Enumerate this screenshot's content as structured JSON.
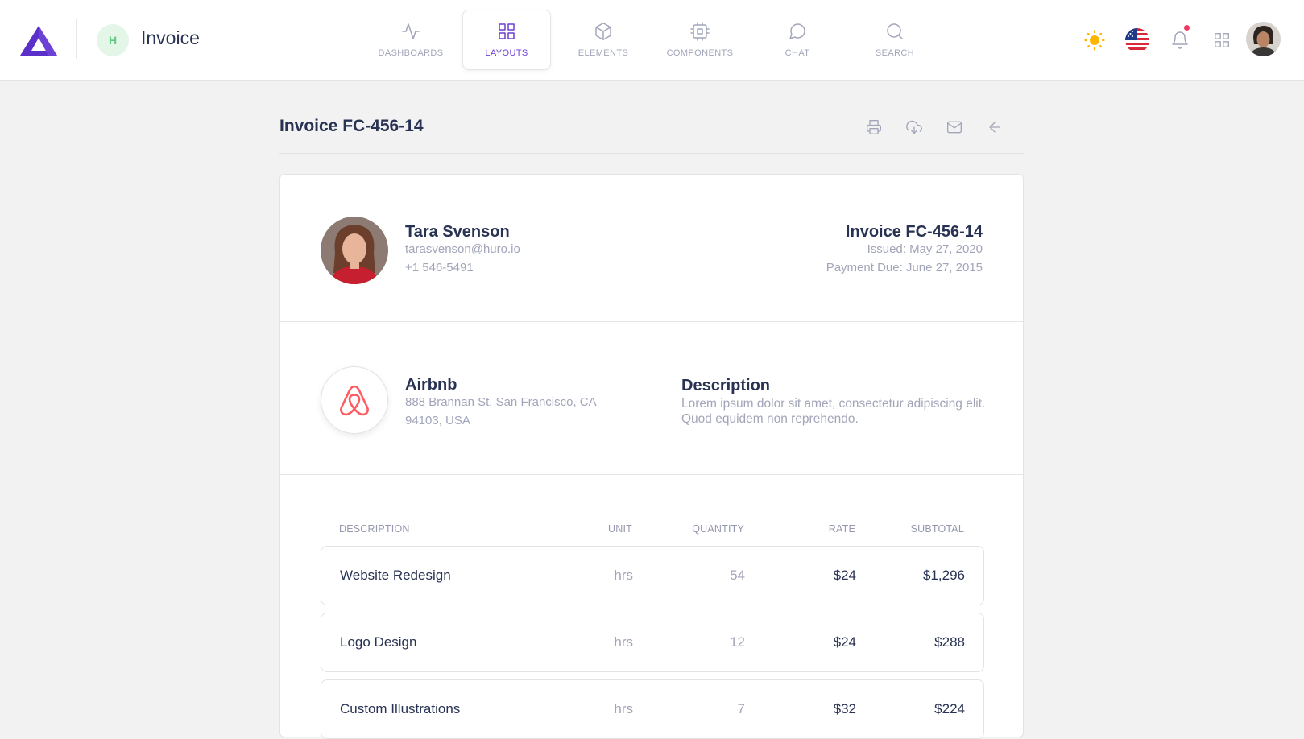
{
  "header": {
    "project_initial": "H",
    "title": "Invoice"
  },
  "nav": [
    {
      "label": "Dashboards",
      "icon": "activity-icon"
    },
    {
      "label": "Layouts",
      "icon": "grid-icon",
      "active": true
    },
    {
      "label": "Elements",
      "icon": "box-icon"
    },
    {
      "label": "Components",
      "icon": "cpu-icon"
    },
    {
      "label": "Chat",
      "icon": "message-circle-icon"
    },
    {
      "label": "Search",
      "icon": "search-icon"
    }
  ],
  "toolbar_icons": [
    "sun-icon",
    "us-flag-icon",
    "bell-icon",
    "apps-grid-icon"
  ],
  "colors": {
    "accent": "#6b3fd4",
    "text_dark": "#283252",
    "text_muted": "#a2a5b9",
    "sun": "#ffb400",
    "notification": "#ee3a61",
    "airbnb": "#ff5a5f"
  },
  "invoice_header": {
    "title": "Invoice FC-456-14",
    "actions": [
      "printer-icon",
      "download-cloud-icon",
      "mail-icon",
      "arrow-left-icon"
    ]
  },
  "client": {
    "name": "Tara Svenson",
    "email": "tarasvenson@huro.io",
    "phone": "+1 546-5491"
  },
  "meta": {
    "invoice_title": "Invoice FC-456-14",
    "issued": "Issued: May 27, 2020",
    "due": "Payment Due: June 27, 2015"
  },
  "company": {
    "name": "Airbnb",
    "address": "888 Brannan St, San Francisco, CA 94103, USA"
  },
  "description": {
    "title": "Description",
    "text": "Lorem ipsum dolor sit amet, consectetur adipiscing elit. Quod equidem non reprehendo."
  },
  "table": {
    "headers": [
      "Description",
      "Unit",
      "Quantity",
      "Rate",
      "Subtotal"
    ],
    "rows": [
      {
        "description": "Website Redesign",
        "unit": "hrs",
        "quantity": "54",
        "rate": "$24",
        "subtotal": "$1,296"
      },
      {
        "description": "Logo Design",
        "unit": "hrs",
        "quantity": "12",
        "rate": "$24",
        "subtotal": "$288"
      },
      {
        "description": "Custom Illustrations",
        "unit": "hrs",
        "quantity": "7",
        "rate": "$32",
        "subtotal": "$224"
      }
    ]
  }
}
